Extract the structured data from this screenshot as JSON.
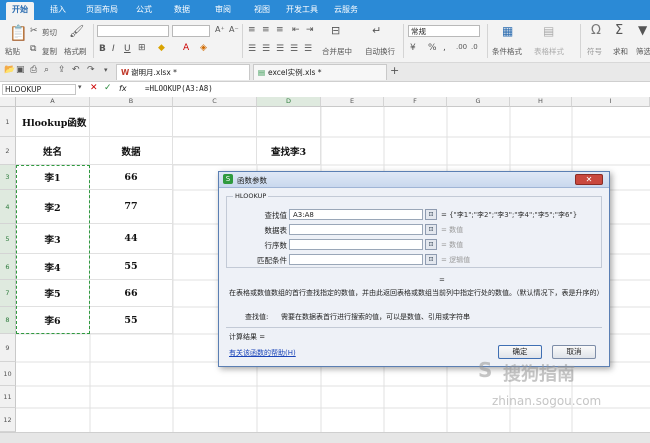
{
  "menu": {
    "items": [
      "开始",
      "插入",
      "页面布局",
      "公式",
      "数据",
      "审阅",
      "视图",
      "开发工具",
      "云服务"
    ],
    "active_index": 0
  },
  "ribbon": {
    "paste_label": "粘贴",
    "cut_label": "剪切",
    "copy_label": "复制",
    "format_painter_label": "格式刷",
    "merge_center_label": "合并居中",
    "wrap_label": "自动换行",
    "number_format": "常规",
    "cond_format_label": "条件格式",
    "table_style_label": "表格样式",
    "symbol_label": "符号",
    "sum_label": "求和",
    "filter_label": "筛选"
  },
  "tabs": [
    {
      "label": "谢明月.xlsx *"
    },
    {
      "label": "excel实例.xls *"
    }
  ],
  "formula_bar": {
    "name_box": "HLOOKUP",
    "fx": "fx",
    "formula": "=HLOOKUP(A3:A8)"
  },
  "grid": {
    "columns": [
      "A",
      "B",
      "C",
      "D",
      "E",
      "F",
      "G",
      "H",
      "I"
    ],
    "rows": [
      "1",
      "2",
      "3",
      "4",
      "5",
      "6",
      "7",
      "8",
      "9",
      "10",
      "11",
      "12"
    ],
    "title_cell": "Hlookup函数",
    "header_name": "姓名",
    "header_data": "数据",
    "lookup_label": "查找李3",
    "names": [
      "李1",
      "李2",
      "李3",
      "李4",
      "李5",
      "李6"
    ],
    "values": [
      "66",
      "77",
      "44",
      "55",
      "66",
      "55"
    ]
  },
  "dialog": {
    "title": "函数参数",
    "function_name": "HLOOKUP",
    "args": [
      {
        "label": "查找值",
        "value": "A3:A8",
        "result": "= {\"李1\";\"李2\";\"李3\";\"李4\";\"李5\";\"李6\"}"
      },
      {
        "label": "数据表",
        "value": "",
        "result": "= 数值"
      },
      {
        "label": "行序数",
        "value": "",
        "result": "= 数值"
      },
      {
        "label": "匹配条件",
        "value": "",
        "result": "= 逻辑值"
      }
    ],
    "equals": "=",
    "description": "在表格或数值数组的首行查找指定的数值，并由此返回表格或数组当前列中指定行处的数值。（默认情况下，表是升序的）",
    "arg_help_label": "查找值:",
    "arg_help_text": "需要在数据表首行进行搜索的值，可以是数值、引用或字符串",
    "result_label": "计算结果 =",
    "help_link": "有关该函数的帮助(H)",
    "ok": "确定",
    "cancel": "取消"
  },
  "watermark": {
    "brand": "搜狗指南",
    "url": "zhinan.sogou.com"
  }
}
